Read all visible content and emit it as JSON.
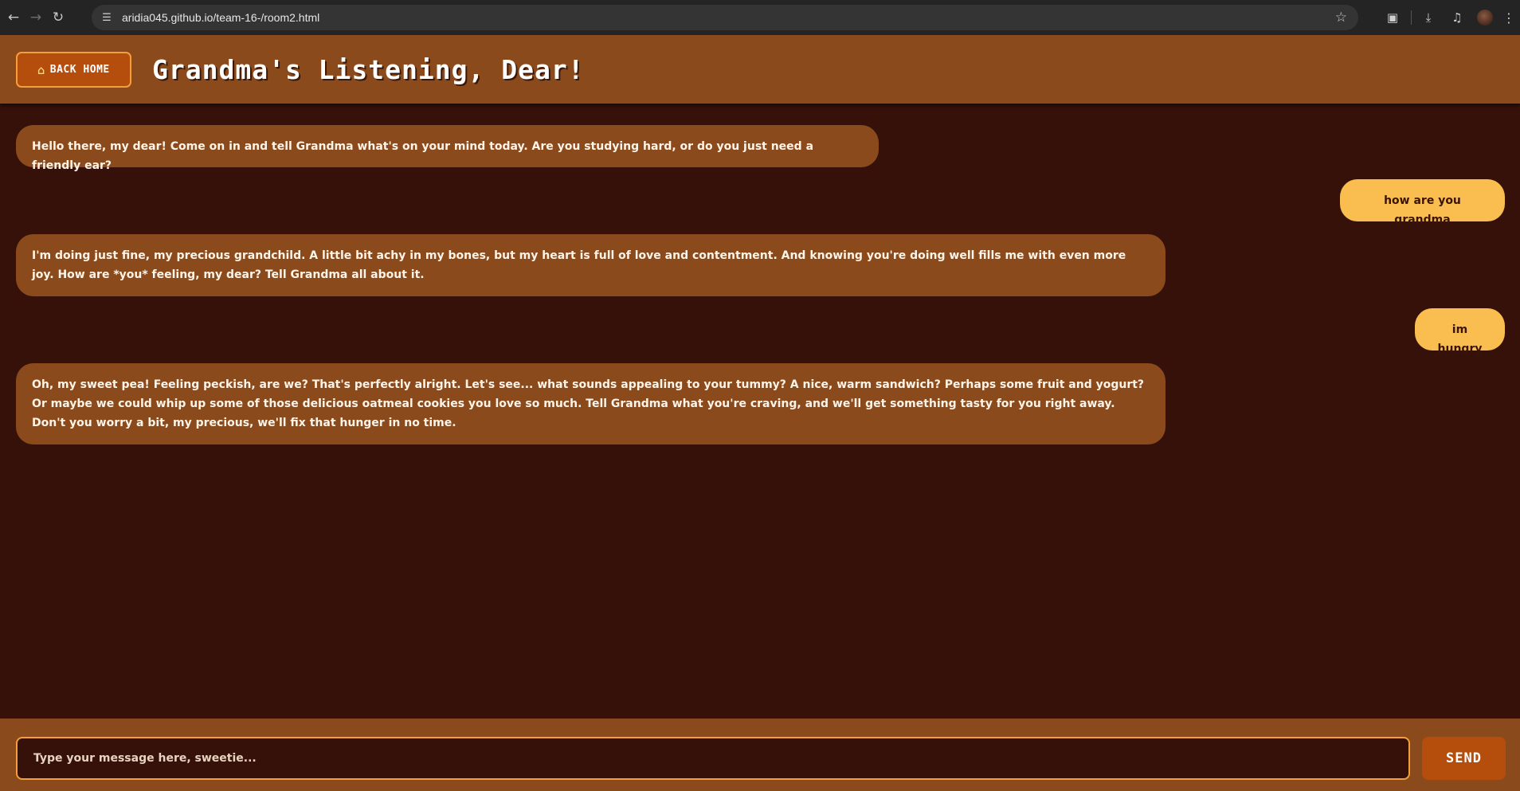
{
  "browser": {
    "url": "aridia045.github.io/team-16-/room2.html",
    "icons": [
      "back-arrow-icon",
      "forward-arrow-icon",
      "reload-icon",
      "site-settings-icon",
      "bookmark-star-icon",
      "extensions-icon",
      "download-icon",
      "media-control-icon",
      "profile-avatar",
      "menu-dots-icon"
    ]
  },
  "header": {
    "back_label": "BACK HOME",
    "home_icon": "house-icon",
    "title": "Grandma's Listening, Dear!"
  },
  "messages": [
    {
      "sender": "grandma",
      "text": "Hello there, my dear! Come on in and tell Grandma what's on your mind today. Are you studying hard, or do you just need a friendly ear?"
    },
    {
      "sender": "user",
      "text": "how are you grandma"
    },
    {
      "sender": "grandma",
      "text": "I'm doing just fine, my precious grandchild. A little bit achy in my bones, but my heart is full of love and contentment. And knowing you're doing well fills me with even more joy. How are *you* feeling, my dear? Tell Grandma all about it."
    },
    {
      "sender": "user",
      "text": "im hungry"
    },
    {
      "sender": "grandma",
      "text": "Oh, my sweet pea! Feeling peckish, are we? That's perfectly alright. Let's see... what sounds appealing to your tummy? A nice, warm sandwich? Perhaps some fruit and yogurt? Or maybe we could whip up some of those delicious oatmeal cookies you love so much. Tell Grandma what you're craving, and we'll get something tasty for you right away. Don't you worry a bit, my precious, we'll fix that hunger in no time."
    }
  ],
  "composer": {
    "placeholder": "Type your message here, sweetie...",
    "value": "",
    "send_label": "SEND"
  },
  "colors": {
    "header_bg": "#8b4a1c",
    "chat_bg": "#351109",
    "user_bubble": "#f9bd50",
    "button_bg": "#b54d0c",
    "accent_border": "#f3a03c"
  }
}
